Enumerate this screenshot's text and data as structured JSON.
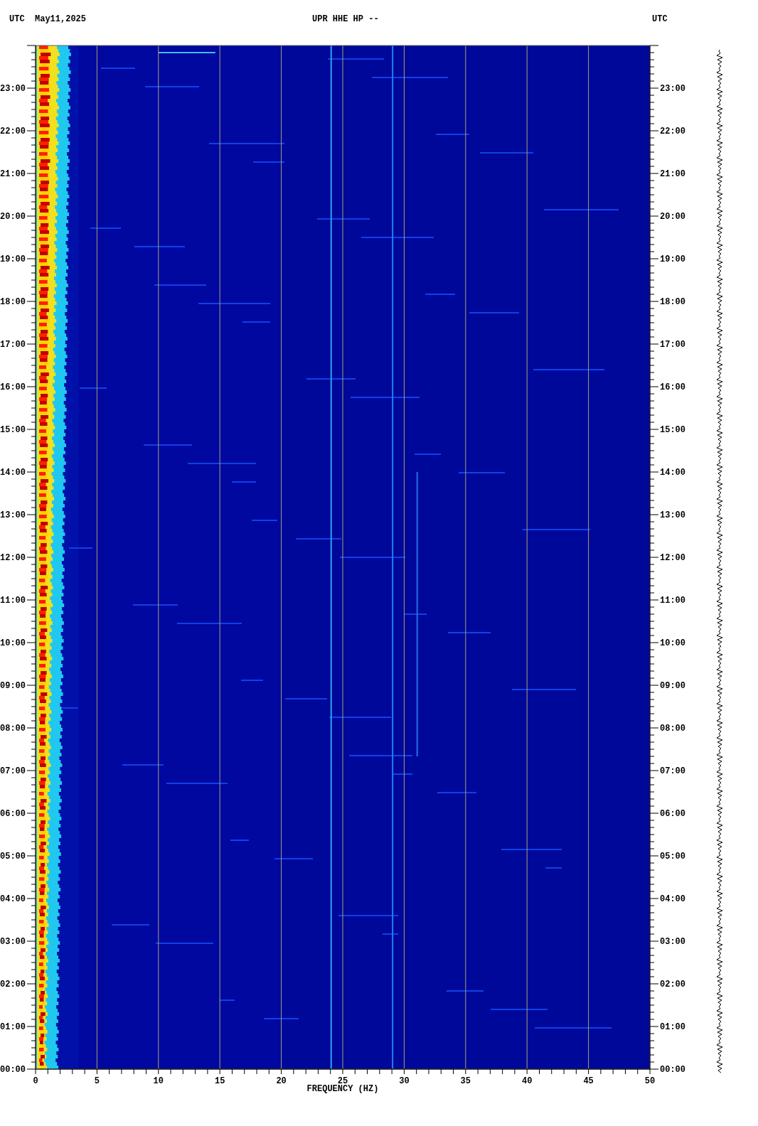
{
  "header": {
    "left_zone": "UTC",
    "date": "May11,2025",
    "title": "UPR HHE HP --",
    "right_zone": "UTC"
  },
  "left_hours": [
    "23:00",
    "22:00",
    "21:00",
    "20:00",
    "19:00",
    "18:00",
    "17:00",
    "16:00",
    "15:00",
    "14:00",
    "13:00",
    "12:00",
    "11:00",
    "10:00",
    "09:00",
    "08:00",
    "07:00",
    "06:00",
    "05:00",
    "04:00",
    "03:00",
    "02:00",
    "01:00",
    "00:00"
  ],
  "right_hours": [
    "23:00",
    "22:00",
    "21:00",
    "20:00",
    "19:00",
    "18:00",
    "17:00",
    "16:00",
    "15:00",
    "14:00",
    "13:00",
    "12:00",
    "11:00",
    "10:00",
    "09:00",
    "08:00",
    "07:00",
    "06:00",
    "05:00",
    "04:00",
    "03:00",
    "02:00",
    "01:00",
    "00:00"
  ],
  "frequency_ticks": [
    "0",
    "5",
    "10",
    "15",
    "20",
    "25",
    "30",
    "35",
    "40",
    "45",
    "50"
  ],
  "xlabel": "FREQUENCY (HZ)"
}
